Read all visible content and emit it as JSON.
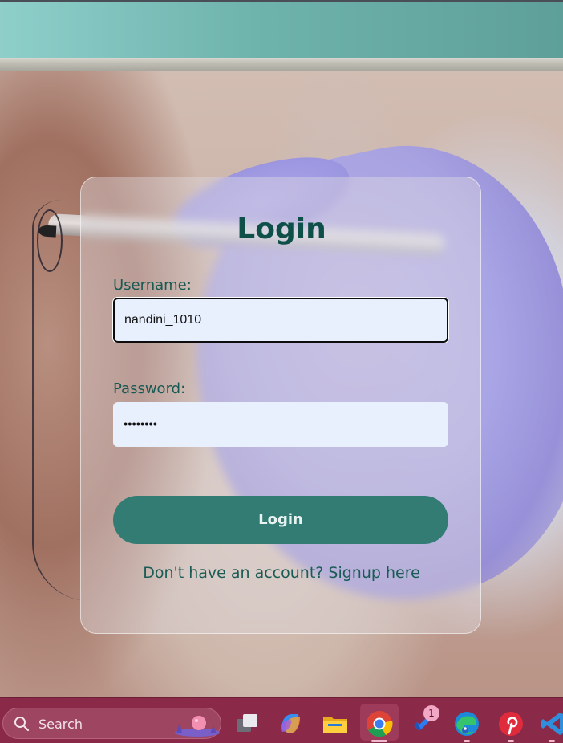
{
  "login": {
    "title": "Login",
    "username_label": "Username:",
    "username_value": "nandini_1010",
    "password_label": "Password:",
    "password_masked": "••••••••",
    "submit_label": "Login",
    "signup_text": "Don't have an account? Signup here"
  },
  "taskbar": {
    "search_label": "Search",
    "icons": [
      "task-view-icon",
      "copilot-icon",
      "file-explorer-icon",
      "chrome-icon",
      "todo-icon",
      "edge-icon",
      "pinterest-icon",
      "vscode-icon"
    ],
    "todo_badge": "1",
    "active_app": "chrome-icon"
  },
  "colors": {
    "title": "#0f4f49",
    "label": "#175a53",
    "button_bg": "#327c74",
    "input_bg": "#e8f0fe",
    "taskbar_bg": "#8b2a48",
    "header_bg": "#6fb3ad"
  }
}
